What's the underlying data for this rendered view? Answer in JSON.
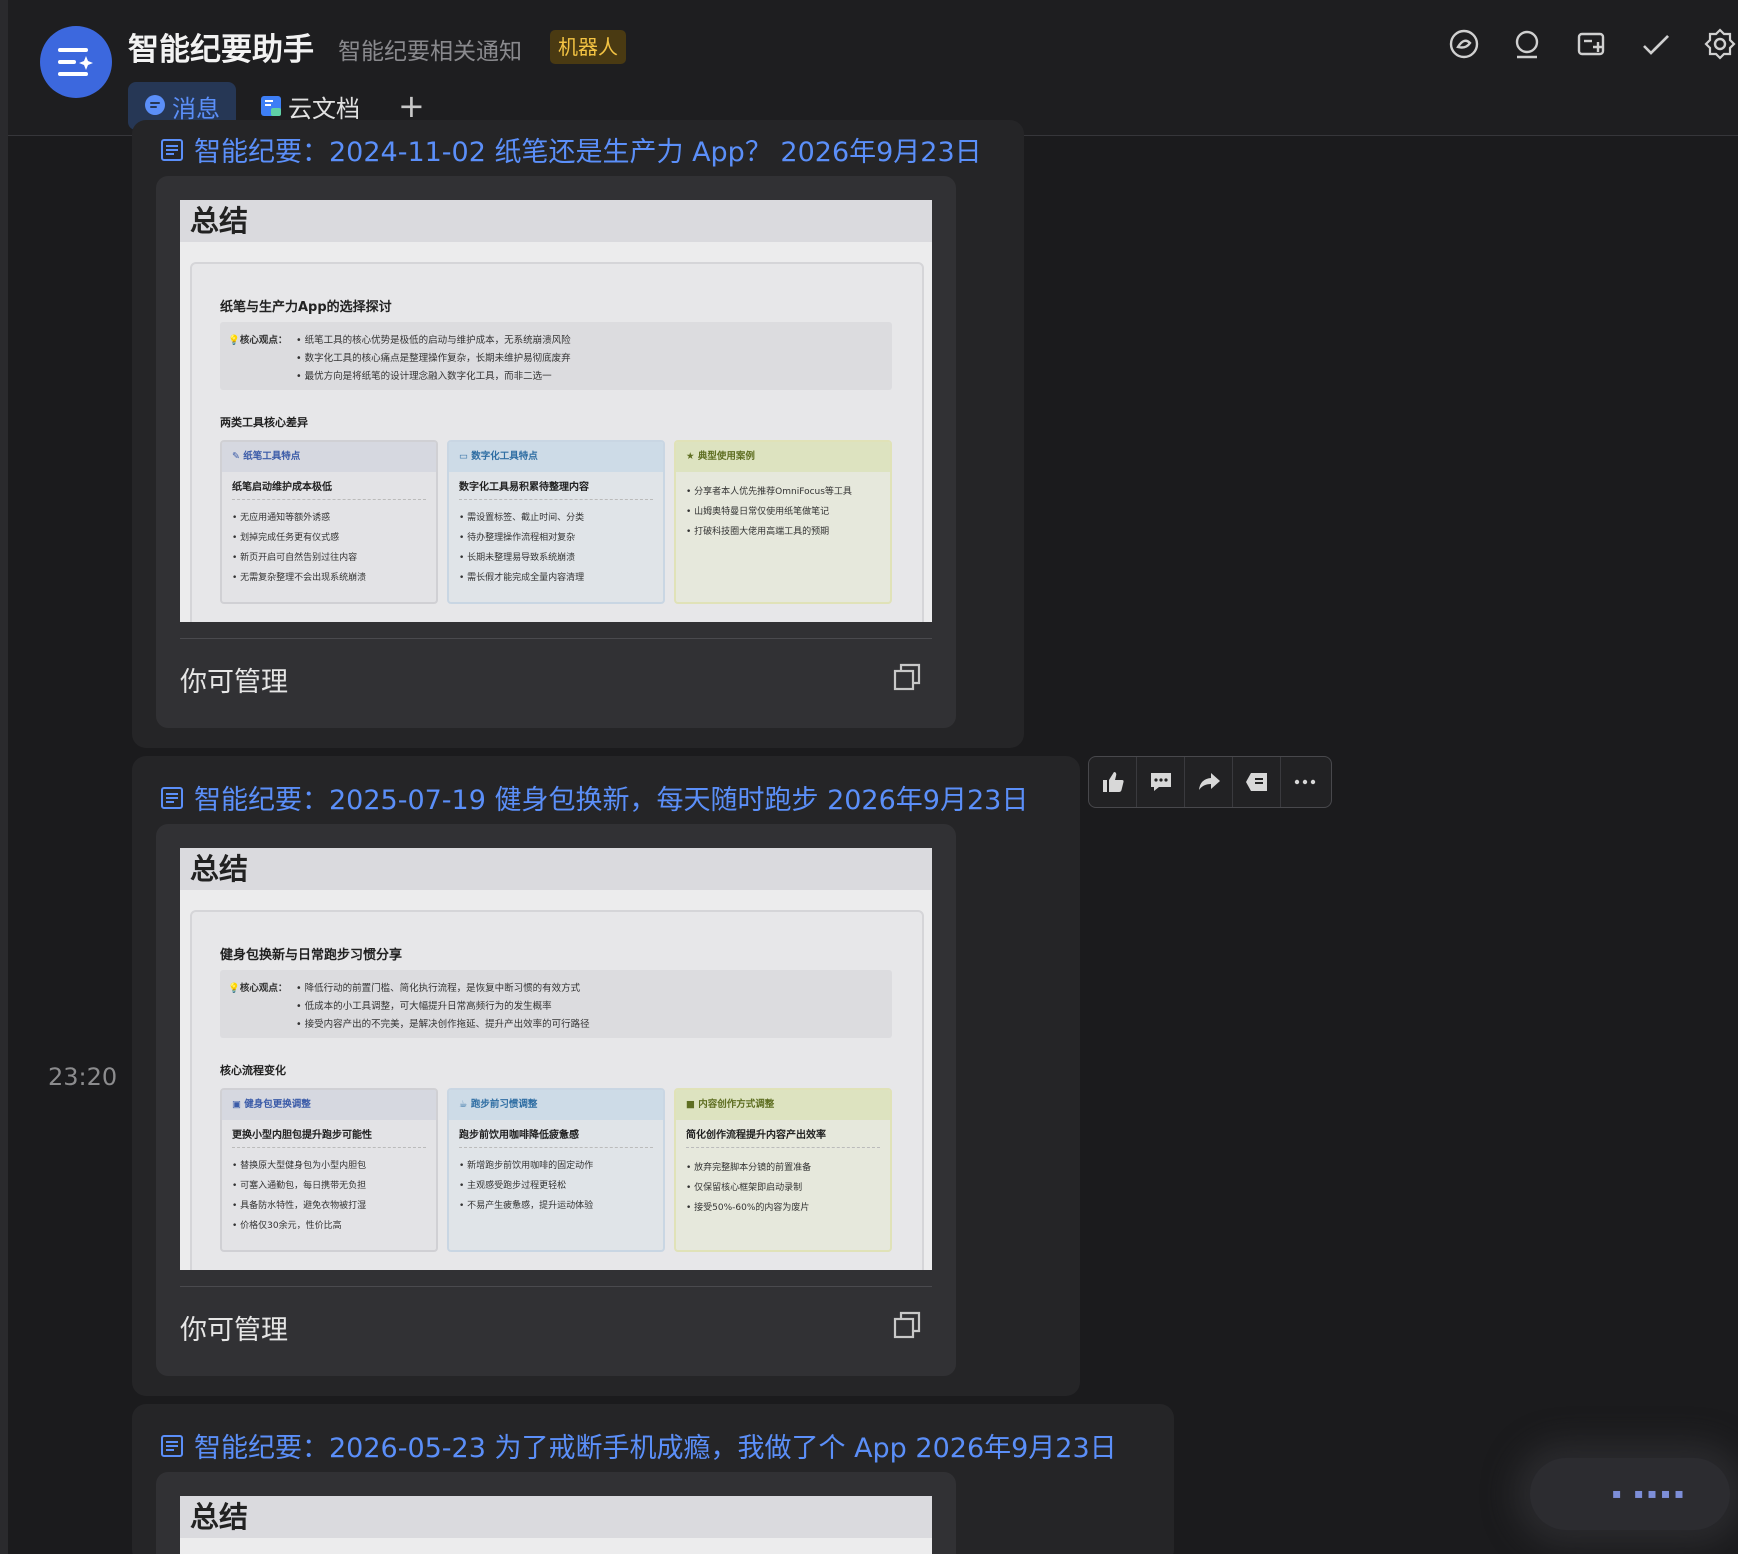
{
  "header": {
    "title": "智能纪要助手",
    "subtitle": "智能纪要相关通知",
    "badge": "机器人",
    "tabs": [
      {
        "label": "消息",
        "icon": "chat-bubble-icon"
      },
      {
        "label": "云文档",
        "icon": "cloud-doc-icon"
      }
    ],
    "add_tab": "+",
    "icons": [
      "pin-icon",
      "search-icon",
      "new-chat-icon",
      "check-icon",
      "gear-icon"
    ],
    "accent": "#5b8ff9",
    "avatar_color": "#3c68de",
    "badge_color": "#f3c343"
  },
  "timestamp": "23:20",
  "messages": [
    {
      "title": "智能纪要：2024-11-02 纸笔还是生产力 App？ 2026年9月23日",
      "card": {
        "summary_heading": "总结",
        "doc_title": "纸笔与生产力App的选择探讨",
        "core_label": "核心观点：",
        "core_points": [
          "纸笔工具的核心优势是极低的启动与维护成本，无系统崩溃风险",
          "数字化工具的核心痛点是整理操作复杂，长期未维护易彻底废弃",
          "最优方向是将纸笔的设计理念融入数字化工具，而非二选一"
        ],
        "section_title": "两类工具核心差异",
        "columns": [
          {
            "head": "纸笔工具特点",
            "sub": "纸笔启动维护成本极低",
            "items": [
              "无应用通知等额外诱惑",
              "划掉完成任务更有仪式感",
              "新页开启可自然告别过往内容",
              "无需复杂整理不会出现系统崩溃"
            ]
          },
          {
            "head": "数字化工具特点",
            "sub": "数字化工具易积累待整理内容",
            "items": [
              "需设置标签、截止时间、分类",
              "待办整理操作流程相对复杂",
              "长期未整理易导致系统崩溃",
              "需长假才能完成全量内容清理"
            ]
          },
          {
            "head": "典型使用案例",
            "sub": "",
            "items": [
              "分享者本人优先推荐OmniFocus等工具",
              "山姆奥特曼日常仅使用纸笔做笔记",
              "打破科技圈大佬用高端工具的预期"
            ]
          }
        ],
        "footer": "你可管理"
      }
    },
    {
      "title": "智能纪要：2025-07-19 健身包换新，每天随时跑步 2026年9月23日",
      "card": {
        "summary_heading": "总结",
        "doc_title": "健身包换新与日常跑步习惯分享",
        "core_label": "核心观点：",
        "core_points": [
          "降低行动的前置门槛、简化执行流程，是恢复中断习惯的有效方式",
          "低成本的小工具调整，可大幅提升日常高频行为的发生概率",
          "接受内容产出的不完美，是解决创作拖延、提升产出效率的可行路径"
        ],
        "section_title": "核心流程变化",
        "columns": [
          {
            "head": "健身包更换调整",
            "sub": "更换小型内胆包提升跑步可能性",
            "items": [
              "替换原大型健身包为小型内胆包",
              "可塞入通勤包，每日携带无负担",
              "具备防水特性，避免衣物被打湿",
              "价格仅30余元，性价比高"
            ]
          },
          {
            "head": "跑步前习惯调整",
            "sub": "跑步前饮用咖啡降低疲惫感",
            "items": [
              "新增跑步前饮用咖啡的固定动作",
              "主观感受跑步过程更轻松",
              "不易产生疲惫感，提升运动体验"
            ]
          },
          {
            "head": "内容创作方式调整",
            "sub": "简化创作流程提升内容产出效率",
            "items": [
              "放弃完整脚本分镜的前置准备",
              "仅保留核心框架即启动录制",
              "接受50%-60%的内容为废片"
            ]
          }
        ],
        "footer": "你可管理"
      }
    },
    {
      "title": "智能纪要：2026-05-23 为了戒断手机成瘾，我做了个 App 2026年9月23日",
      "card": {
        "summary_heading": "总结"
      }
    }
  ],
  "toolbar": {
    "icons": [
      "thumbs-up-icon",
      "comment-icon",
      "forward-icon",
      "quote-icon",
      "more-icon"
    ]
  }
}
